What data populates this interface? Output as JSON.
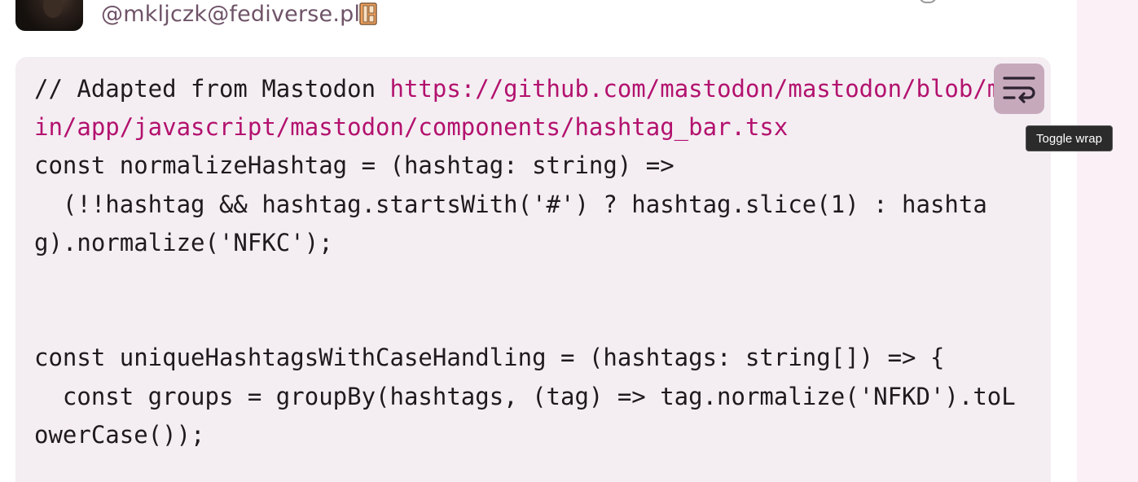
{
  "post": {
    "handle": "@mkljczk@fediverse.pl",
    "handle_icon": "pleroma-logo-icon"
  },
  "code_block": {
    "lines": [
      {
        "plain": "// Adapted from Mastodon ",
        "link": "https://github.com/mastodon/mastodon/blob/m"
      },
      {
        "plain": "",
        "link": "in/app/javascript/mastodon/components/hashtag_bar.tsx"
      },
      {
        "plain": "const normalizeHashtag = (hashtag: string) =>",
        "link": ""
      },
      {
        "plain": "  (!!hashtag && hashtag.startsWith('#') ? hashtag.slice(1) : hashta",
        "link": ""
      },
      {
        "plain": "g).normalize('NFKC');",
        "link": ""
      },
      {
        "plain": "",
        "link": ""
      },
      {
        "plain": "",
        "link": ""
      },
      {
        "plain": "const uniqueHashtagsWithCaseHandling = (hashtags: string[]) => {",
        "link": ""
      },
      {
        "plain": "  const groups = groupBy(hashtags, (tag) => tag.normalize('NFKD').toL",
        "link": ""
      },
      {
        "plain": "owerCase());",
        "link": ""
      }
    ],
    "toggle_wrap_icon": "wrap-text-icon",
    "toggle_wrap_tooltip": "Toggle wrap"
  },
  "colors": {
    "link": "#b3126e",
    "code_background": "#f4eef3",
    "button_background": "#c7a9bc",
    "handle": "#6f5368"
  }
}
